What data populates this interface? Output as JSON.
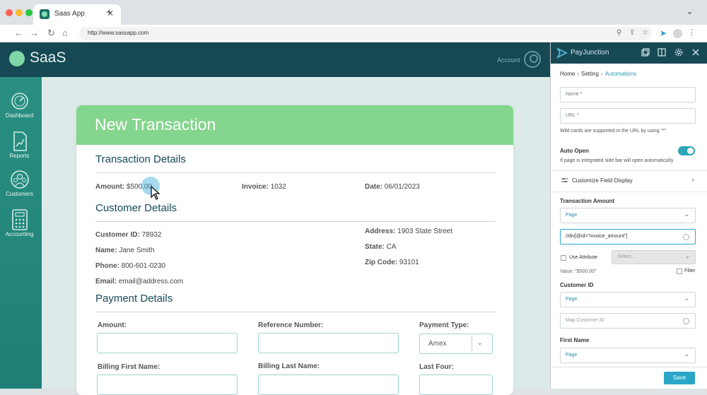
{
  "browser": {
    "tab_title": "Saas App",
    "tab_close": "✕",
    "new_tab": "+",
    "url": "http://www.sassapp.com"
  },
  "app": {
    "logo_text": "SaaS",
    "account_label": "Account",
    "sidebar": [
      {
        "label": "Dashboard",
        "icon": "gauge-icon"
      },
      {
        "label": "Reports",
        "icon": "report-icon"
      },
      {
        "label": "Customers",
        "icon": "customers-icon"
      },
      {
        "label": "Accounting",
        "icon": "calculator-icon"
      }
    ]
  },
  "transaction": {
    "title": "New Transaction",
    "details_title": "Transaction Details",
    "amount_label": "Amount:",
    "amount_value": "$500.00",
    "invoice_label": "Invoice:",
    "invoice_value": "1032",
    "date_label": "Date:",
    "date_value": "06/01/2023",
    "customer_title": "Customer Details",
    "customer_id_label": "Customer ID:",
    "customer_id_value": "78932",
    "name_label": "Name:",
    "name_value": "Jane Smith",
    "phone_label": "Phone:",
    "phone_value": "800-601-0230",
    "email_label": "Email:",
    "email_value": "email@address.com",
    "address_label": "Address:",
    "address_value": "1903 State Street",
    "state_label": "State:",
    "state_value": "CA",
    "zip_label": "Zip Code:",
    "zip_value": "93101",
    "payment_title": "Payment Details",
    "pay_amount_label": "Amount:",
    "reference_label": "Reference Number:",
    "payment_type_label": "Payment Type:",
    "payment_type_value": "Amex",
    "billing_first_label": "Billing First Name:",
    "billing_last_label": "Billing Last Name:",
    "last_four_label": "Last Four:"
  },
  "panel": {
    "brand": "PayJunction",
    "crumbs": [
      "Home",
      "Setting",
      "Automations"
    ],
    "name_placeholder": "Name *",
    "url_placeholder": "URL *",
    "wildcard_note": "Wild cards are supported in the URL by using \"*\"",
    "auto_open_label": "Auto Open",
    "auto_open_note": "If page is integrated side bar will open automatically",
    "customize_label": "Customize Field Display",
    "txn_amount_label": "Transaction Amount",
    "page_option": "Page",
    "xpath_value": "//div[@id=\"invoice_amount\"]",
    "use_attribute_label": "Use Attribute",
    "select_placeholder": "Select...",
    "value_note": "Value: \"$500.00\"",
    "filter_label": "Filter",
    "customer_id_label": "Customer ID",
    "map_customer_placeholder": "Map Customer ID",
    "first_name_label": "First Name",
    "save_label": "Save"
  },
  "colors": {
    "header": "#174955",
    "accent_green": "#84d58d",
    "sidebar": "#2a8f82",
    "panel_accent": "#2aa7b8"
  }
}
